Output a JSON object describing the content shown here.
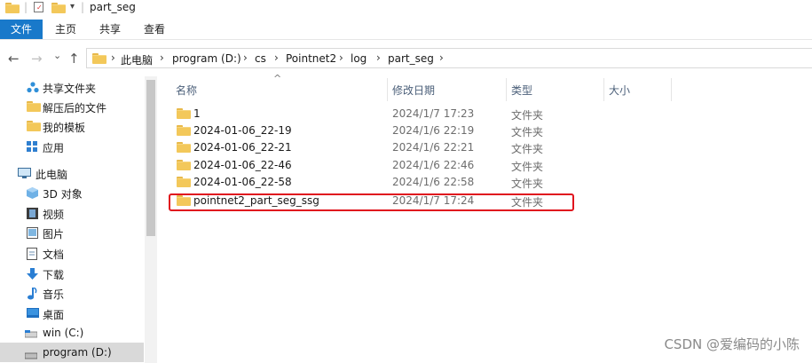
{
  "titlebar": {
    "path_text": "part_seg",
    "dropdown_glyph": "▾",
    "separator": "|"
  },
  "ribbon": {
    "tabs": [
      "文件",
      "主页",
      "共享",
      "查看"
    ]
  },
  "nav": {
    "back": "←",
    "forward": "→",
    "recent": "⌄",
    "up": "↑"
  },
  "breadcrumb": {
    "chevron": "›",
    "items": [
      "此电脑",
      "program (D:)",
      "cs",
      "Pointnet2",
      "log",
      "part_seg"
    ]
  },
  "sidebar": {
    "items": [
      {
        "label": "共享文件夹",
        "icon": "share-folder-icon"
      },
      {
        "label": "解压后的文件",
        "icon": "folder-icon"
      },
      {
        "label": "我的模板",
        "icon": "folder-icon"
      },
      {
        "label": "应用",
        "icon": "apps-icon"
      },
      {
        "label": "此电脑",
        "icon": "computer-icon"
      },
      {
        "label": "3D 对象",
        "icon": "cube-icon"
      },
      {
        "label": "视频",
        "icon": "video-icon"
      },
      {
        "label": "图片",
        "icon": "pictures-icon"
      },
      {
        "label": "文档",
        "icon": "document-icon"
      },
      {
        "label": "下载",
        "icon": "download-icon"
      },
      {
        "label": "音乐",
        "icon": "music-icon"
      },
      {
        "label": "桌面",
        "icon": "desktop-icon"
      },
      {
        "label": "win (C:)",
        "icon": "drive-icon"
      },
      {
        "label": "program (D:)",
        "icon": "drive-icon"
      }
    ]
  },
  "columns": {
    "name": "名称",
    "modified": "修改日期",
    "type": "类型",
    "size": "大小",
    "sort_glyph": "^"
  },
  "files": [
    {
      "name": "1",
      "modified": "2024/1/7 17:23",
      "type": "文件夹"
    },
    {
      "name": "2024-01-06_22-19",
      "modified": "2024/1/6 22:19",
      "type": "文件夹"
    },
    {
      "name": "2024-01-06_22-21",
      "modified": "2024/1/6 22:21",
      "type": "文件夹"
    },
    {
      "name": "2024-01-06_22-46",
      "modified": "2024/1/6 22:46",
      "type": "文件夹"
    },
    {
      "name": "2024-01-06_22-58",
      "modified": "2024/1/6 22:58",
      "type": "文件夹"
    },
    {
      "name": "pointnet2_part_seg_ssg",
      "modified": "2024/1/7 17:24",
      "type": "文件夹"
    }
  ],
  "colors": {
    "ribbon_file_tab": "#1979ca",
    "folder": "#f3c85a",
    "highlight": "#e0141e"
  },
  "watermark": "CSDN @爱编码的小陈"
}
